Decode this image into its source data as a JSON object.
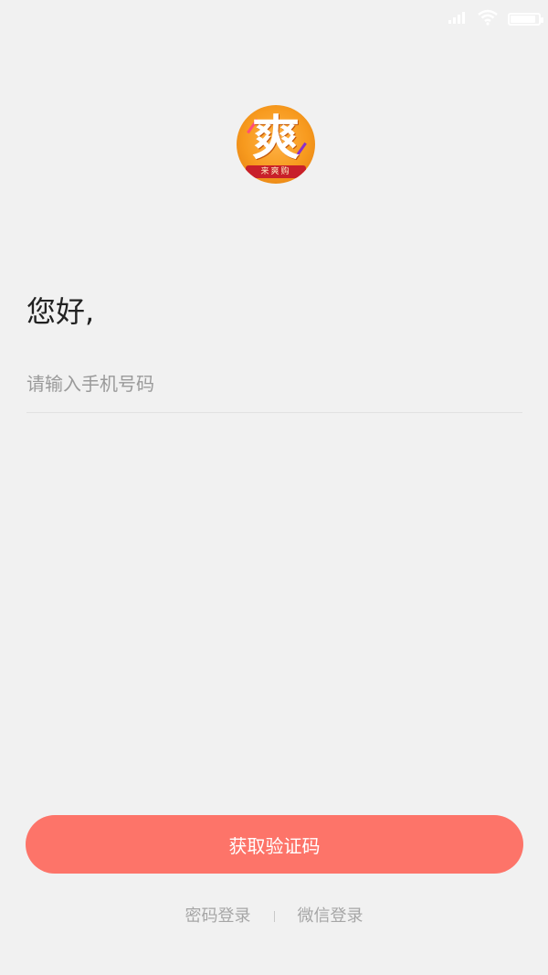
{
  "status_bar": {
    "signal_icon": "signal-icon",
    "wifi_icon": "wifi-icon",
    "battery_icon": "battery-icon",
    "battery_level": 0.9
  },
  "logo": {
    "char": "爽",
    "ribbon_text": "来爽购"
  },
  "greeting": "您好,",
  "phone_input": {
    "value": "",
    "placeholder": "请输入手机号码"
  },
  "get_code_button": {
    "label": "获取验证码"
  },
  "alt_login": {
    "password_login": "密码登录",
    "wechat_login": "微信登录"
  },
  "colors": {
    "background": "#f1f1f1",
    "accent": "#fd7469",
    "link_text": "#a6a6a6",
    "placeholder": "#9a9a9a"
  }
}
